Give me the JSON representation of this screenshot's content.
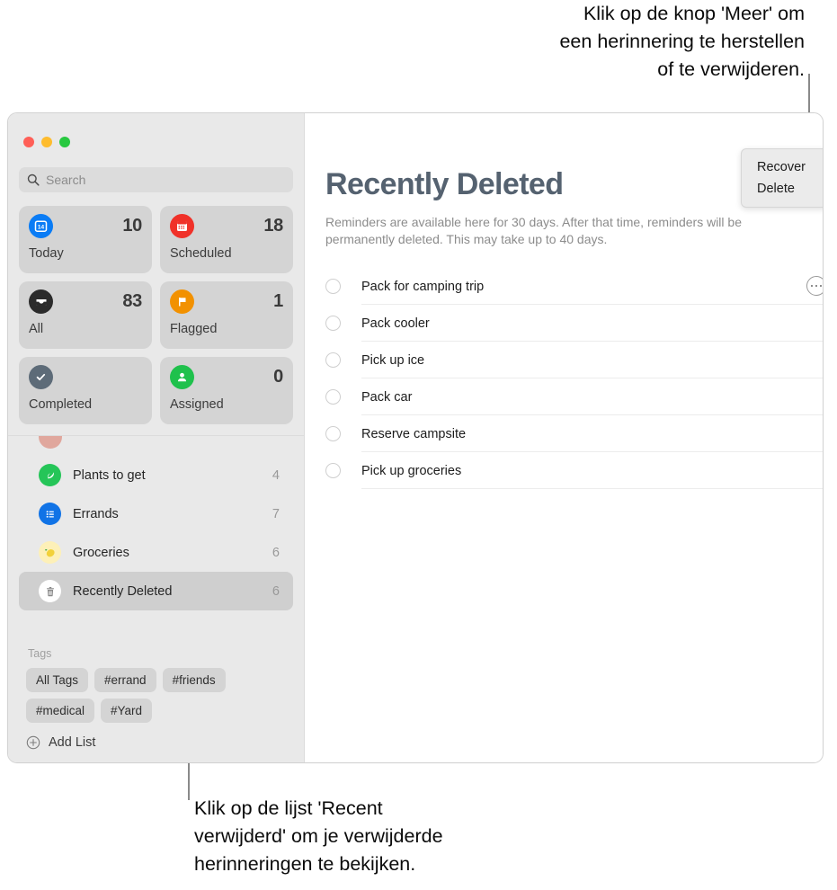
{
  "annotations": {
    "top": "Klik op de knop 'Meer' om\neen herinnering te herstellen\nof te verwijderen.",
    "bottom": "Klik op de lijst 'Recent\nverwijderd' om je verwijderde\nherinneringen te bekijken."
  },
  "window": {
    "traffic_lights": [
      {
        "name": "close",
        "color": "#ff5f57"
      },
      {
        "name": "minimize",
        "color": "#febc2e"
      },
      {
        "name": "zoom",
        "color": "#28c840"
      }
    ]
  },
  "sidebar": {
    "search": {
      "placeholder": "Search",
      "value": "",
      "icon": "search-icon"
    },
    "smart_lists": [
      {
        "label": "Today",
        "count": "10",
        "icon": "calendar-day-icon",
        "color": "#0a7cf5"
      },
      {
        "label": "Scheduled",
        "count": "18",
        "icon": "calendar-icon",
        "color": "#f03129"
      },
      {
        "label": "All",
        "count": "83",
        "icon": "inbox-tray-icon",
        "color": "#2b2b2b"
      },
      {
        "label": "Flagged",
        "count": "1",
        "icon": "flag-icon",
        "color": "#f29100"
      },
      {
        "label": "Completed",
        "count": "",
        "icon": "checkmark-icon",
        "color": "#5d6b78"
      },
      {
        "label": "Assigned",
        "count": "0",
        "icon": "person-icon",
        "color": "#1fc14c"
      }
    ],
    "lists": [
      {
        "name": "Plants to get",
        "count": "4",
        "icon": "leaf-icon",
        "color": "#25c558",
        "selected": false
      },
      {
        "name": "Errands",
        "count": "7",
        "icon": "bullet-list-icon",
        "color": "#1173e6",
        "selected": false
      },
      {
        "name": "Groceries",
        "count": "6",
        "icon": "lemon-icon",
        "color": "#fdf0b8",
        "selected": false
      },
      {
        "name": "Recently Deleted",
        "count": "6",
        "icon": "trash-icon",
        "color": "#ffffff",
        "selected": true
      }
    ],
    "tags": {
      "title": "Tags",
      "chips": [
        "All Tags",
        "#errand",
        "#friends",
        "#medical",
        "#Yard"
      ]
    },
    "add_list": {
      "label": "Add List",
      "icon": "plus-circle-icon"
    }
  },
  "content": {
    "title": "Recently Deleted",
    "subtitle": "Reminders are available here for 30 days. After that time, reminders will be permanently deleted. This may take up to 40 days.",
    "reminders": [
      {
        "text": "Pack for camping trip"
      },
      {
        "text": "Pack cooler"
      },
      {
        "text": "Pick up ice"
      },
      {
        "text": "Pack car"
      },
      {
        "text": "Reserve campsite"
      },
      {
        "text": "Pick up groceries"
      }
    ],
    "more_button": {
      "icon": "ellipsis-icon",
      "label": "More"
    },
    "popup_menu": {
      "items": [
        {
          "label": "Recover"
        },
        {
          "label": "Delete"
        }
      ]
    }
  },
  "colors": {
    "title": "#556270",
    "sidebar_bg": "#e9e9e9",
    "card_bg": "#d4d4d4",
    "selected_row": "#cfcfcf"
  }
}
